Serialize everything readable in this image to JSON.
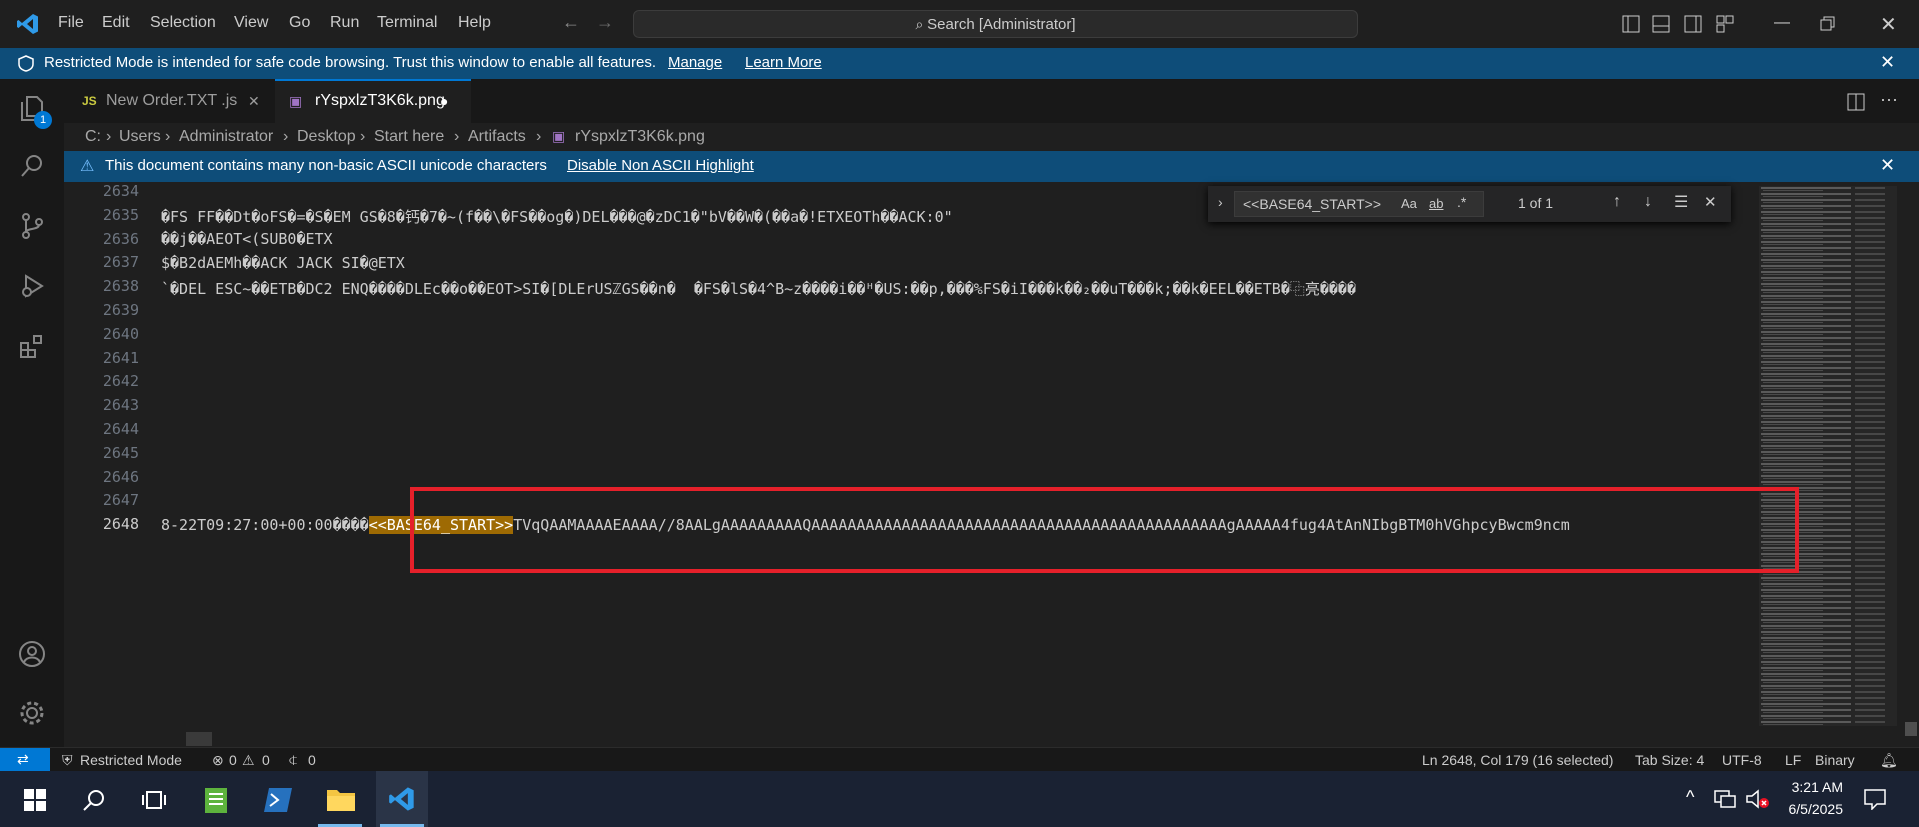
{
  "titlebar": {
    "menus": [
      "File",
      "Edit",
      "Selection",
      "View",
      "Go",
      "Run",
      "Terminal",
      "Help"
    ],
    "search_text": "Search [Administrator]"
  },
  "banner": {
    "message": "Restricted Mode is intended for safe code browsing. Trust this window to enable all features.",
    "manage": "Manage",
    "learn_more": "Learn More"
  },
  "activity": {
    "badge": "1"
  },
  "tabs": [
    {
      "icon": "JS",
      "label": "New Order.TXT .js"
    },
    {
      "label": "rYspxlzT3K6k.png"
    }
  ],
  "breadcrumb": [
    "C:",
    "Users",
    "Administrator",
    "Desktop",
    "Start here",
    "Artifacts",
    "rYspxlzT3K6k.png"
  ],
  "ascii_banner": {
    "message": "This document contains many non-basic ASCII unicode characters",
    "action": "Disable Non ASCII Highlight"
  },
  "find": {
    "query": "<<BASE64_START>>",
    "result": "1 of 1",
    "opt_case": "Aa",
    "opt_word": "ab",
    "opt_regex": ".*"
  },
  "editor": {
    "line_numbers": [
      "2634",
      "2635",
      "2636",
      "2637",
      "2638",
      "2639",
      "2640",
      "2641",
      "2642",
      "2643",
      "2644",
      "2645",
      "2646",
      "2647",
      "2648"
    ],
    "line_2635": "�FS FF��Dt�oFS�=�S�EM GS�8�钙�7�~(f��\\�FS��og�)DEL���@�zDC1�\"bV��W�(��a�!ETXEOTh��ACK:0\"",
    "line_2636": "��j��AEOT<(SUB0�ETX",
    "line_2637": "$�B2dAEMh��ACK JACK SI�@ETX",
    "line_2638": "`�DEL ESC~��ETB�DC2 ENQ����DLEc��o��EOT>SI�[DLErUSℤGS��n�  �FS�lS�4^B~z����i��ᴴ�US:��p,���%FS�iI���k��₂��uT���k;��k�EEL��ETB�⿻亮����",
    "line_2648_prefix": "8-22T09:27:00+00:00����",
    "line_2648_match": "<<BASE64_START>>",
    "line_2648_rest": "TVqQAAMAAAAEAAAA//8AALgAAAAAAAAAQAAAAAAAAAAAAAAAAAAAAAAAAAAAAAAAAAAAAAAAAAAAAAAgAAAAA4fug4AtAnNIbgBTM0hVGhpcyBwcm9ncm"
  },
  "status": {
    "mode": "Restricted Mode",
    "errors": "0",
    "warnings": "0",
    "ports": "0",
    "position": "Ln 2648, Col 179 (16 selected)",
    "tab_size": "Tab Size: 4",
    "encoding": "UTF-8",
    "eol": "LF",
    "language": "Binary"
  },
  "taskbar": {
    "time": "3:21 AM",
    "date": "6/5/2025"
  },
  "colors": {
    "accent": "#0078d4",
    "banner": "#0e4d79",
    "highlight": "#9e6a03",
    "redbox": "#e5202a"
  }
}
